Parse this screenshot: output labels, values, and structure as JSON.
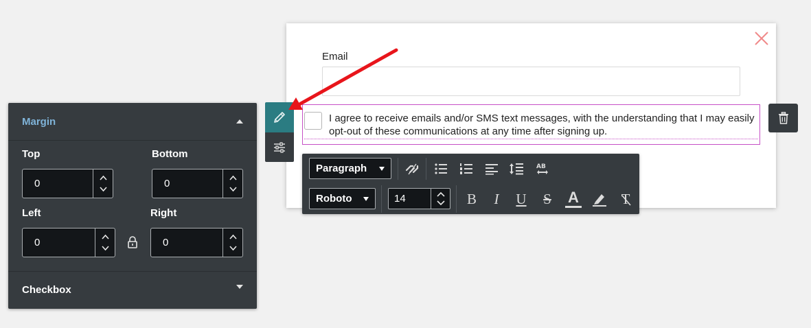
{
  "form": {
    "email_label": "Email",
    "email_value": "",
    "consent_text": "I agree to receive emails and/or SMS text messages, with the understanding that I may easily opt-out of these communications at any time after signing up."
  },
  "toolbar": {
    "block_type": "Paragraph",
    "font_family": "Roboto",
    "font_size": "14",
    "bold": "B",
    "italic": "I",
    "underline": "U",
    "strikethrough": "S",
    "font_color": "A",
    "clear_format": "T"
  },
  "panel": {
    "section_title": "Margin",
    "top_label": "Top",
    "top_value": "0",
    "bottom_label": "Bottom",
    "bottom_value": "0",
    "left_label": "Left",
    "left_value": "0",
    "right_label": "Right",
    "right_value": "0",
    "checkbox_title": "Checkbox"
  },
  "colors": {
    "panel_bg": "#363b3f",
    "accent_teal": "#2b7c82",
    "section_title": "#7fb3d8",
    "selection_outline": "#c64fc6",
    "close_icon": "#f08a8a",
    "annotation_arrow": "#e8151b"
  }
}
